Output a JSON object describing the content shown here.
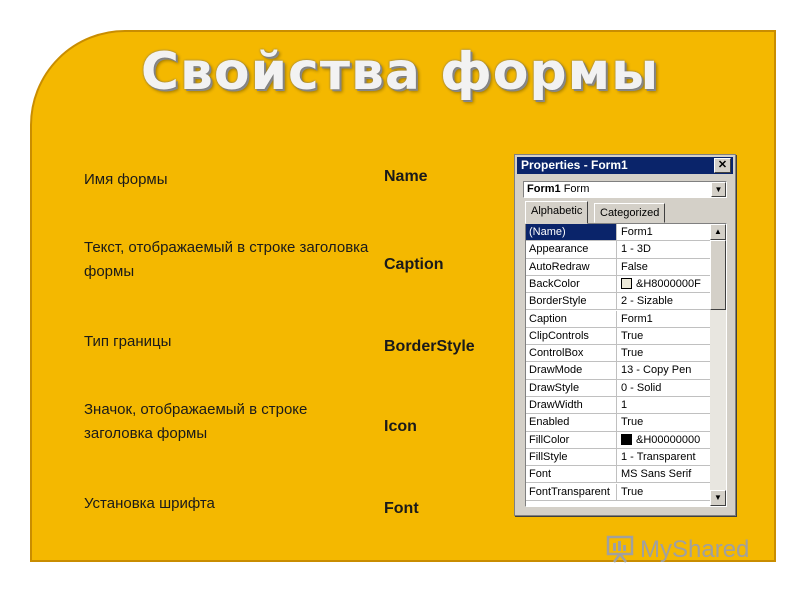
{
  "slide": {
    "title": "Свойства формы",
    "rows": [
      {
        "desc": "Имя формы",
        "prop": "Name"
      },
      {
        "desc": "Текст, отображаемый в строке заголовка формы",
        "prop": "Caption"
      },
      {
        "desc": "Тип границы",
        "prop": "BorderStyle"
      },
      {
        "desc": "Значок, отображаемый в строке заголовка формы",
        "prop": "Icon"
      },
      {
        "desc": "Установка шрифта",
        "prop": "Font"
      }
    ]
  },
  "properties_window": {
    "title": "Properties - Form1",
    "close_glyph": "✕",
    "object_name": "Form1",
    "object_type": "Form",
    "tabs": [
      "Alphabetic",
      "Categorized"
    ],
    "active_tab": "Alphabetic",
    "grid": [
      {
        "name": "(Name)",
        "value": "Form1"
      },
      {
        "name": "Appearance",
        "value": "1 - 3D"
      },
      {
        "name": "AutoRedraw",
        "value": "False"
      },
      {
        "name": "BackColor",
        "value": "&H8000000F",
        "swatch": "#ece9d8"
      },
      {
        "name": "BorderStyle",
        "value": "2 - Sizable"
      },
      {
        "name": "Caption",
        "value": "Form1"
      },
      {
        "name": "ClipControls",
        "value": "True"
      },
      {
        "name": "ControlBox",
        "value": "True"
      },
      {
        "name": "DrawMode",
        "value": "13 - Copy Pen"
      },
      {
        "name": "DrawStyle",
        "value": "0 - Solid"
      },
      {
        "name": "DrawWidth",
        "value": "1"
      },
      {
        "name": "Enabled",
        "value": "True"
      },
      {
        "name": "FillColor",
        "value": "&H00000000",
        "swatch": "#000000"
      },
      {
        "name": "FillStyle",
        "value": "1 - Transparent"
      },
      {
        "name": "Font",
        "value": "MS Sans Serif"
      },
      {
        "name": "FontTransparent",
        "value": "True"
      }
    ]
  },
  "watermark": {
    "text": "MyShared",
    "icon": "presentation-board-icon"
  },
  "colors": {
    "slide_bg": "#f4b800",
    "titlebar": "#0a246a",
    "window": "#d4d0c8"
  }
}
